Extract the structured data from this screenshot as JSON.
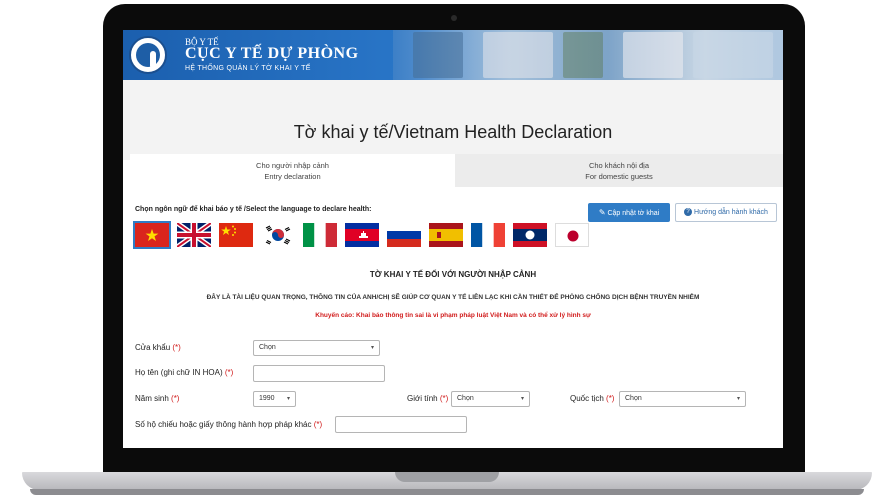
{
  "header": {
    "ministry": "BỘ Y TẾ",
    "department": "CỤC Y TẾ DỰ PHÒNG",
    "system_name": "HỆ THỐNG QUẢN LÝ TỜ KHAI Y TẾ"
  },
  "page_title": "Tờ khai y tế/Vietnam Health Declaration",
  "tabs": [
    {
      "line1": "Cho người nhập cảnh",
      "line2": "Entry declaration"
    },
    {
      "line1": "Cho khách nội địa",
      "line2": "For domestic guests"
    }
  ],
  "language_prompt": "Chọn ngôn ngữ để khai báo y tế /Select the language to declare health:",
  "buttons": {
    "update": "Cập nhật tờ khai",
    "guide": "Hướng dẫn hành khách"
  },
  "flags": [
    "vietnam",
    "united-kingdom",
    "china",
    "south-korea",
    "italy",
    "cambodia",
    "russia",
    "spain",
    "france",
    "laos",
    "japan"
  ],
  "declaration": {
    "title": "TỜ KHAI Y TẾ ĐỐI VỚI NGƯỜI NHẬP CẢNH",
    "notice": "ĐÂY LÀ TÀI LIỆU QUAN TRỌNG, THÔNG TIN CỦA ANH/CHỊ SẼ GIÚP CƠ QUAN Y TẾ LIÊN LẠC KHI CẦN THIẾT ĐỂ PHÒNG CHỐNG DỊCH BỆNH TRUYỀN NHIỄM",
    "warning": "Khuyến cáo: Khai báo thông tin sai là vi phạm pháp luật Việt Nam và có thể xử lý hình sự"
  },
  "form": {
    "required_mark": "(*)",
    "border_gate_label": "Cửa khẩu",
    "border_gate_value": "Chọn",
    "name_label": "Họ tên (ghi chữ IN HOA)",
    "birth_year_label": "Năm sinh",
    "birth_year_value": "1990",
    "gender_label": "Giới tính",
    "gender_value": "Chọn",
    "nationality_label": "Quốc tịch",
    "nationality_value": "Chọn",
    "passport_label": "Số hộ chiếu hoặc giấy thông hành hợp pháp khác"
  },
  "colors": {
    "accent": "#2f7cc6",
    "warning": "#d11b1b",
    "banner": "#1b5fae"
  }
}
